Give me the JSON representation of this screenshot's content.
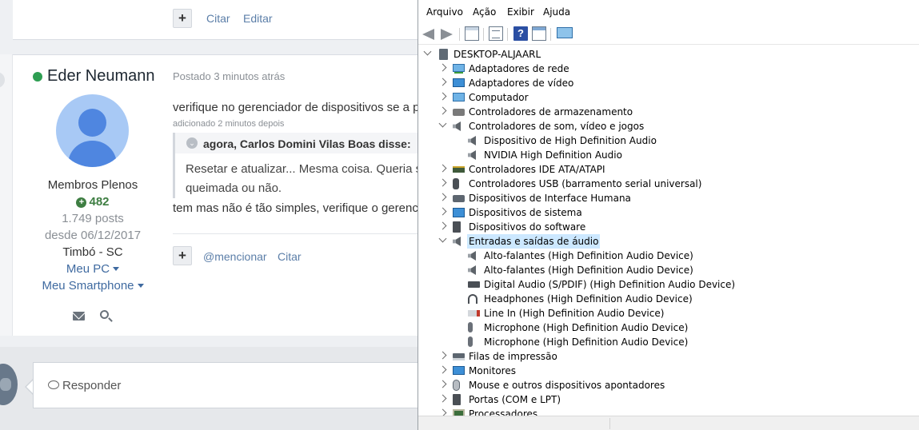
{
  "forum": {
    "top_post": {
      "plus_label": "+",
      "actions": [
        "Citar",
        "Editar"
      ]
    },
    "post": {
      "author": "Eder Neumann",
      "posted": "Postado 3 minutos atrás",
      "text1": "verifique no gerenciador de dispositivos se a p",
      "added": "adicionado 2 minutos depois",
      "quote": {
        "chevron": "⌄",
        "author": "agora, Carlos Domini Vilas Boas disse:",
        "line1": "Resetar e atualizar... Mesma coisa. Queria s",
        "line2": "queimada ou não."
      },
      "text2": "tem mas não é tão simples, verifique o gerenc",
      "plus_label": "+",
      "actions": [
        "@mencionar",
        "Citar"
      ]
    },
    "profile": {
      "rank": "Membros Plenos",
      "reputation": "482",
      "posts": "1.749 posts",
      "since": "desde 06/12/2017",
      "location": "Timbó - SC",
      "links": [
        "Meu PC",
        "Meu Smartphone"
      ]
    },
    "reply": {
      "placeholder": "Responder"
    }
  },
  "device_manager": {
    "menu": [
      "Arquivo",
      "Ação",
      "Exibir",
      "Ajuda"
    ],
    "toolbar_help_glyph": "?",
    "tree": [
      {
        "level": 0,
        "expander": "open",
        "icon": "computer-icon",
        "label": "DESKTOP-ALJAARL"
      },
      {
        "level": 1,
        "expander": "closed",
        "icon": "network-adapter-icon",
        "label": "Adaptadores de rede"
      },
      {
        "level": 1,
        "expander": "closed",
        "icon": "display-adapter-icon",
        "label": "Adaptadores de vídeo"
      },
      {
        "level": 1,
        "expander": "closed",
        "icon": "computer-icon",
        "label": "Computador"
      },
      {
        "level": 1,
        "expander": "closed",
        "icon": "storage-controller-icon",
        "label": "Controladores de armazenamento"
      },
      {
        "level": 1,
        "expander": "open",
        "icon": "speaker-icon",
        "label": "Controladores de som, vídeo e jogos"
      },
      {
        "level": 2,
        "expander": "none",
        "icon": "speaker-icon",
        "label": "Dispositivo de High Definition Audio"
      },
      {
        "level": 2,
        "expander": "none",
        "icon": "speaker-icon",
        "label": "NVIDIA High Definition Audio"
      },
      {
        "level": 1,
        "expander": "closed",
        "icon": "ide-controller-icon",
        "label": "Controladores IDE ATA/ATAPI"
      },
      {
        "level": 1,
        "expander": "closed",
        "icon": "usb-icon",
        "label": "Controladores USB (barramento serial universal)"
      },
      {
        "level": 1,
        "expander": "closed",
        "icon": "hid-keyboard-icon",
        "label": "Dispositivos de Interface Humana"
      },
      {
        "level": 1,
        "expander": "closed",
        "icon": "system-device-icon",
        "label": "Dispositivos de sistema"
      },
      {
        "level": 1,
        "expander": "closed",
        "icon": "software-device-icon",
        "label": "Dispositivos do software"
      },
      {
        "level": 1,
        "expander": "open",
        "icon": "speaker-icon",
        "label": "Entradas e saídas de áudio",
        "selected": true
      },
      {
        "level": 2,
        "expander": "none",
        "icon": "speaker-icon",
        "label": "Alto-falantes (High Definition Audio Device)"
      },
      {
        "level": 2,
        "expander": "none",
        "icon": "speaker-icon",
        "label": "Alto-falantes (High Definition Audio Device)"
      },
      {
        "level": 2,
        "expander": "none",
        "icon": "spdif-icon",
        "label": "Digital Audio (S/PDIF) (High Definition Audio Device)"
      },
      {
        "level": 2,
        "expander": "none",
        "icon": "headphones-icon",
        "label": "Headphones (High Definition Audio Device)"
      },
      {
        "level": 2,
        "expander": "none",
        "icon": "line-in-icon",
        "label": "Line In (High Definition Audio Device)"
      },
      {
        "level": 2,
        "expander": "none",
        "icon": "microphone-icon",
        "label": "Microphone (High Definition Audio Device)"
      },
      {
        "level": 2,
        "expander": "none",
        "icon": "microphone-icon",
        "label": "Microphone (High Definition Audio Device)"
      },
      {
        "level": 1,
        "expander": "closed",
        "icon": "printer-icon",
        "label": "Filas de impressão"
      },
      {
        "level": 1,
        "expander": "closed",
        "icon": "monitor-icon",
        "label": "Monitores"
      },
      {
        "level": 1,
        "expander": "closed",
        "icon": "mouse-icon",
        "label": "Mouse e outros dispositivos apontadores"
      },
      {
        "level": 1,
        "expander": "closed",
        "icon": "port-icon",
        "label": "Portas (COM e LPT)"
      },
      {
        "level": 1,
        "expander": "closed",
        "icon": "processor-icon",
        "label": "Processadores"
      }
    ]
  }
}
